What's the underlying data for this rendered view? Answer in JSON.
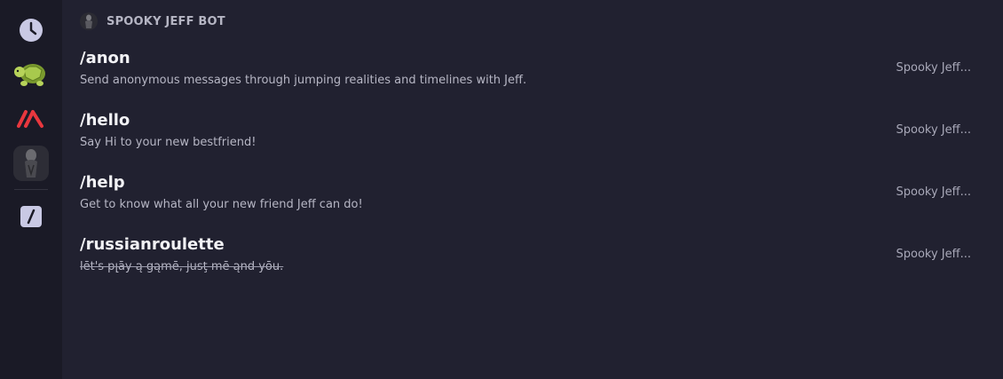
{
  "rail": {
    "items": [
      {
        "name": "recent-icon",
        "label": ""
      },
      {
        "name": "turtle-app-icon",
        "label": ""
      },
      {
        "name": "red-stripes-app-icon",
        "label": ""
      },
      {
        "name": "spooky-jeff-app-icon",
        "label": ""
      },
      {
        "name": "slash-commands-icon",
        "label": ""
      }
    ]
  },
  "section": {
    "title": "SPOOKY JEFF BOT"
  },
  "commands": [
    {
      "name": "/anon",
      "description": "Send anonymous messages through jumping realities and timelines with Jeff.",
      "source": "Spooky Jeff..."
    },
    {
      "name": "/hello",
      "description": "Say Hi to your new bestfriend!",
      "source": "Spooky Jeff..."
    },
    {
      "name": "/help",
      "description": "Get to know what all your new friend Jeff can do!",
      "source": "Spooky Jeff..."
    },
    {
      "name": "/russianroulette",
      "description": "lēt's pլāy ą gąmē, jusţ mē ąnd yōu.",
      "source": "Spooky Jeff..."
    }
  ],
  "colors": {
    "rail_bg": "#1a1a26",
    "main_bg": "#212130",
    "accent_red": "#e8373e",
    "turtle_green": "#9bc44a"
  }
}
